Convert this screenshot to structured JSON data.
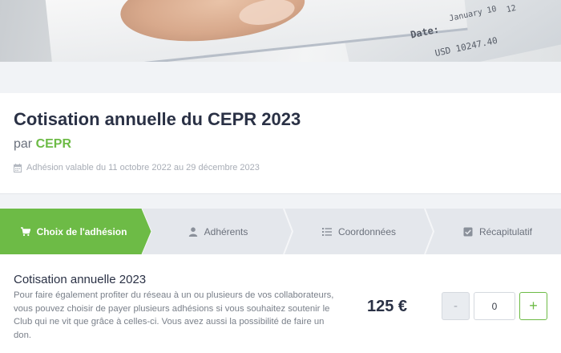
{
  "hero": {
    "texts": [
      "Date:",
      "January 10",
      "USD 10247.40",
      "12"
    ]
  },
  "event": {
    "title": "Cotisation annuelle du CEPR 2023",
    "by_prefix": "par",
    "organizer": "CEPR",
    "validity_icon": "calendar-icon",
    "validity": "Adhésion valable du 11 octobre 2022 au 29 décembre 2023"
  },
  "steps": [
    {
      "label": "Choix de l'adhésion",
      "icon": "cart-icon",
      "active": true
    },
    {
      "label": "Adhérents",
      "icon": "user-icon",
      "active": false
    },
    {
      "label": "Coordonnées",
      "icon": "list-icon",
      "active": false
    },
    {
      "label": "Récapitulatif",
      "icon": "check-square-icon",
      "active": false
    }
  ],
  "product": {
    "title": "Cotisation annuelle 2023",
    "description": "Pour faire également profiter du réseau à un ou plusieurs de vos collaborateurs, vous pouvez choisir de payer plusieurs adhésions si vous souhaitez soutenir le Club qui ne vit que grâce à celles-ci. Vous avez aussi la possibilité de faire un don.",
    "price": "125 €",
    "minus_label": "-",
    "quantity": "0",
    "plus_label": "+"
  },
  "colors": {
    "accent": "#6dbb46",
    "stepper_bg": "#e4e7ec",
    "title": "#2a3145"
  }
}
